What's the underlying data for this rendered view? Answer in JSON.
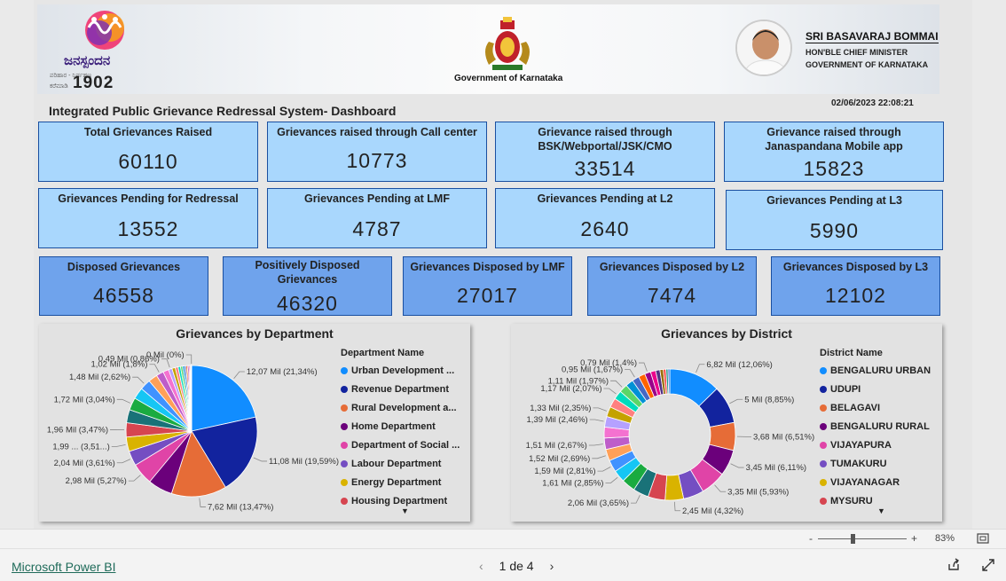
{
  "banner": {
    "brand_name": "ಜನಸ್ಪಂದನ",
    "brand_tagline": "ಪರಿಹಾರ - ನಿರ್ವಹಣ",
    "brand_number_prefix": "ಕರೆಮಾಡಿ",
    "brand_number": "1902",
    "government_label": "Government of Karnataka",
    "cm_name": "SRI BASAVARAJ BOMMAI",
    "cm_title_line1": "HON'BLE CHIEF MINISTER",
    "cm_title_line2": "GOVERNMENT OF KARNATAKA"
  },
  "timestamp": "02/06/2023 22:08:21",
  "dashboard_title": "Integrated Public Grievance Redressal System-  Dashboard",
  "kpi_row1": [
    {
      "label": "Total Grievances Raised",
      "value": "60110"
    },
    {
      "label": "Grievances raised through Call center",
      "value": "10773"
    },
    {
      "label": "Grievance raised through BSK/Webportal/JSK/CMO",
      "value": "33514"
    },
    {
      "label": "Grievance raised through Janaspandana Mobile app",
      "value": "15823"
    }
  ],
  "kpi_row2": [
    {
      "label": "Grievances Pending for Redressal",
      "value": "13552"
    },
    {
      "label": "Grievances Pending at LMF",
      "value": "4787"
    },
    {
      "label": "Grievances Pending at L2",
      "value": "2640"
    },
    {
      "label": "Grievances Pending at L3",
      "value": "5990"
    }
  ],
  "kpi_row3": [
    {
      "label": "Disposed Grievances",
      "value": "46558"
    },
    {
      "label": "Positively Disposed Grievances",
      "value": "46320"
    },
    {
      "label": "Grievances Disposed by LMF",
      "value": "27017"
    },
    {
      "label": "Grievances Disposed by L2",
      "value": "7474"
    },
    {
      "label": "Grievances Disposed by L3",
      "value": "12102"
    }
  ],
  "chart_data": [
    {
      "type": "pie",
      "title": "Grievances by Department",
      "legend_title": "Department Name",
      "legend_position": "right",
      "legend": [
        {
          "name": "Urban Development ...",
          "color": "#118dff"
        },
        {
          "name": "Revenue Department",
          "color": "#12239e"
        },
        {
          "name": "Rural Development a...",
          "color": "#e66c37"
        },
        {
          "name": "Home Department",
          "color": "#6b007b"
        },
        {
          "name": "Department of Social ...",
          "color": "#e044a7"
        },
        {
          "name": "Labour Department",
          "color": "#744ec2"
        },
        {
          "name": "Energy Department",
          "color": "#d9b300"
        },
        {
          "name": "Housing Department",
          "color": "#d64550"
        }
      ],
      "slices": [
        {
          "label": "12,07 Mil (21,34%)",
          "value": 21.34,
          "color": "#118dff"
        },
        {
          "label": "11,08 Mil (19,59%)",
          "value": 19.59,
          "color": "#12239e"
        },
        {
          "label": "7,62 Mil (13,47%)",
          "value": 13.47,
          "color": "#e66c37"
        },
        {
          "label": "",
          "value": 6.0,
          "color": "#6b007b"
        },
        {
          "label": "2,98 Mil (5,27%)",
          "value": 5.27,
          "color": "#e044a7"
        },
        {
          "label": "2,04 Mil (3,61%)",
          "value": 3.61,
          "color": "#744ec2"
        },
        {
          "label": "1,99 ... (3,51...)",
          "value": 3.51,
          "color": "#d9b300"
        },
        {
          "label": "1,96 Mil (3,47%)",
          "value": 3.47,
          "color": "#d64550"
        },
        {
          "label": "",
          "value": 3.2,
          "color": "#197278"
        },
        {
          "label": "1,72 Mil (3,04%)",
          "value": 3.04,
          "color": "#1aab40"
        },
        {
          "label": "",
          "value": 2.8,
          "color": "#15c6f4"
        },
        {
          "label": "1,48 Mil (2,62%)",
          "value": 2.62,
          "color": "#4092ff"
        },
        {
          "label": "",
          "value": 2.2,
          "color": "#ffa058"
        },
        {
          "label": "1,02 Mil (1,8%)",
          "value": 1.8,
          "color": "#be5dc9"
        },
        {
          "label": "",
          "value": 1.4,
          "color": "#f472d0"
        },
        {
          "label": "0,49 Mil (0,86%)",
          "value": 0.86,
          "color": "#b5a1ff"
        },
        {
          "label": "",
          "value": 0.8,
          "color": "#c4a200"
        },
        {
          "label": "",
          "value": 0.7,
          "color": "#ff8080"
        },
        {
          "label": "",
          "value": 0.6,
          "color": "#00dbbc"
        },
        {
          "label": "",
          "value": 0.5,
          "color": "#5bd667"
        },
        {
          "label": "",
          "value": 0.45,
          "color": "#0091d5"
        },
        {
          "label": "",
          "value": 0.4,
          "color": "#4668c5"
        },
        {
          "label": "",
          "value": 0.35,
          "color": "#ff6300"
        },
        {
          "label": "",
          "value": 0.3,
          "color": "#99008a"
        },
        {
          "label": "",
          "value": 0.25,
          "color": "#ec008c"
        },
        {
          "label": "",
          "value": 0.2,
          "color": "#533285"
        },
        {
          "label": "",
          "value": 0.15,
          "color": "#99700a"
        },
        {
          "label": "0 Mil (0%)",
          "value": 0.1,
          "color": "#ff4141"
        }
      ]
    },
    {
      "type": "pie",
      "donut": true,
      "title": "Grievances by District",
      "legend_title": "District Name",
      "legend_position": "right",
      "legend": [
        {
          "name": "BENGALURU URBAN",
          "color": "#118dff"
        },
        {
          "name": "UDUPI",
          "color": "#12239e"
        },
        {
          "name": "BELAGAVI",
          "color": "#e66c37"
        },
        {
          "name": "BENGALURU RURAL",
          "color": "#6b007b"
        },
        {
          "name": "VIJAYAPURA",
          "color": "#e044a7"
        },
        {
          "name": "TUMAKURU",
          "color": "#744ec2"
        },
        {
          "name": "VIJAYANAGAR",
          "color": "#d9b300"
        },
        {
          "name": "MYSURU",
          "color": "#d64550"
        }
      ],
      "slices": [
        {
          "label": "6,82 Mil (12,06%)",
          "value": 12.06,
          "color": "#118dff"
        },
        {
          "label": "5 Mil (8,85%)",
          "value": 8.85,
          "color": "#12239e"
        },
        {
          "label": "3,68 Mil (6,51%)",
          "value": 6.51,
          "color": "#e66c37"
        },
        {
          "label": "3,45 Mil (6,11%)",
          "value": 6.11,
          "color": "#6b007b"
        },
        {
          "label": "3,35 Mil (5,93%)",
          "value": 5.93,
          "color": "#e044a7"
        },
        {
          "label": "",
          "value": 4.8,
          "color": "#744ec2"
        },
        {
          "label": "2,45 Mil (4,32%)",
          "value": 4.32,
          "color": "#d9b300"
        },
        {
          "label": "",
          "value": 4.0,
          "color": "#d64550"
        },
        {
          "label": "2,06 Mil (3,65%)",
          "value": 3.65,
          "color": "#197278"
        },
        {
          "label": "",
          "value": 3.2,
          "color": "#1aab40"
        },
        {
          "label": "1,61 Mil (2,85%)",
          "value": 2.85,
          "color": "#15c6f4"
        },
        {
          "label": "1,59 Mil (2,81%)",
          "value": 2.81,
          "color": "#4092ff"
        },
        {
          "label": "1,52 Mil (2,69%)",
          "value": 2.69,
          "color": "#ffa058"
        },
        {
          "label": "1,51 Mil (2,67%)",
          "value": 2.67,
          "color": "#be5dc9"
        },
        {
          "label": "",
          "value": 2.55,
          "color": "#f472d0"
        },
        {
          "label": "1,39 Mil (2,46%)",
          "value": 2.46,
          "color": "#b5a1ff"
        },
        {
          "label": "1,33 Mil (2,35%)",
          "value": 2.35,
          "color": "#c4a200"
        },
        {
          "label": "",
          "value": 2.2,
          "color": "#ff8080"
        },
        {
          "label": "1,17 Mil (2,07%)",
          "value": 2.07,
          "color": "#00dbbc"
        },
        {
          "label": "1,11 Mil (1,97%)",
          "value": 1.97,
          "color": "#5bd667"
        },
        {
          "label": "",
          "value": 1.8,
          "color": "#0091d5"
        },
        {
          "label": "0,95 Mil (1,67%)",
          "value": 1.67,
          "color": "#4668c5"
        },
        {
          "label": "",
          "value": 1.55,
          "color": "#ff6300"
        },
        {
          "label": "0,79 Mil (1,4%)",
          "value": 1.4,
          "color": "#99008a"
        },
        {
          "label": "",
          "value": 1.2,
          "color": "#ec008c"
        },
        {
          "label": "",
          "value": 1.0,
          "color": "#533285"
        },
        {
          "label": "",
          "value": 0.8,
          "color": "#99700a"
        },
        {
          "label": "",
          "value": 0.6,
          "color": "#ff4141"
        },
        {
          "label": "",
          "value": 0.5,
          "color": "#1f9a85"
        },
        {
          "label": "",
          "value": 0.4,
          "color": "#255dcd"
        }
      ]
    }
  ],
  "zoom": {
    "minus": "-",
    "plus": "+",
    "level": "83%"
  },
  "footer": {
    "brand_link": "Microsoft Power BI",
    "page_indicator": "1 de 4",
    "prev": "‹",
    "next": "›"
  },
  "icons": {
    "fit_page": "fit-to-page-icon",
    "share": "share-icon",
    "fullscreen": "fullscreen-icon"
  }
}
